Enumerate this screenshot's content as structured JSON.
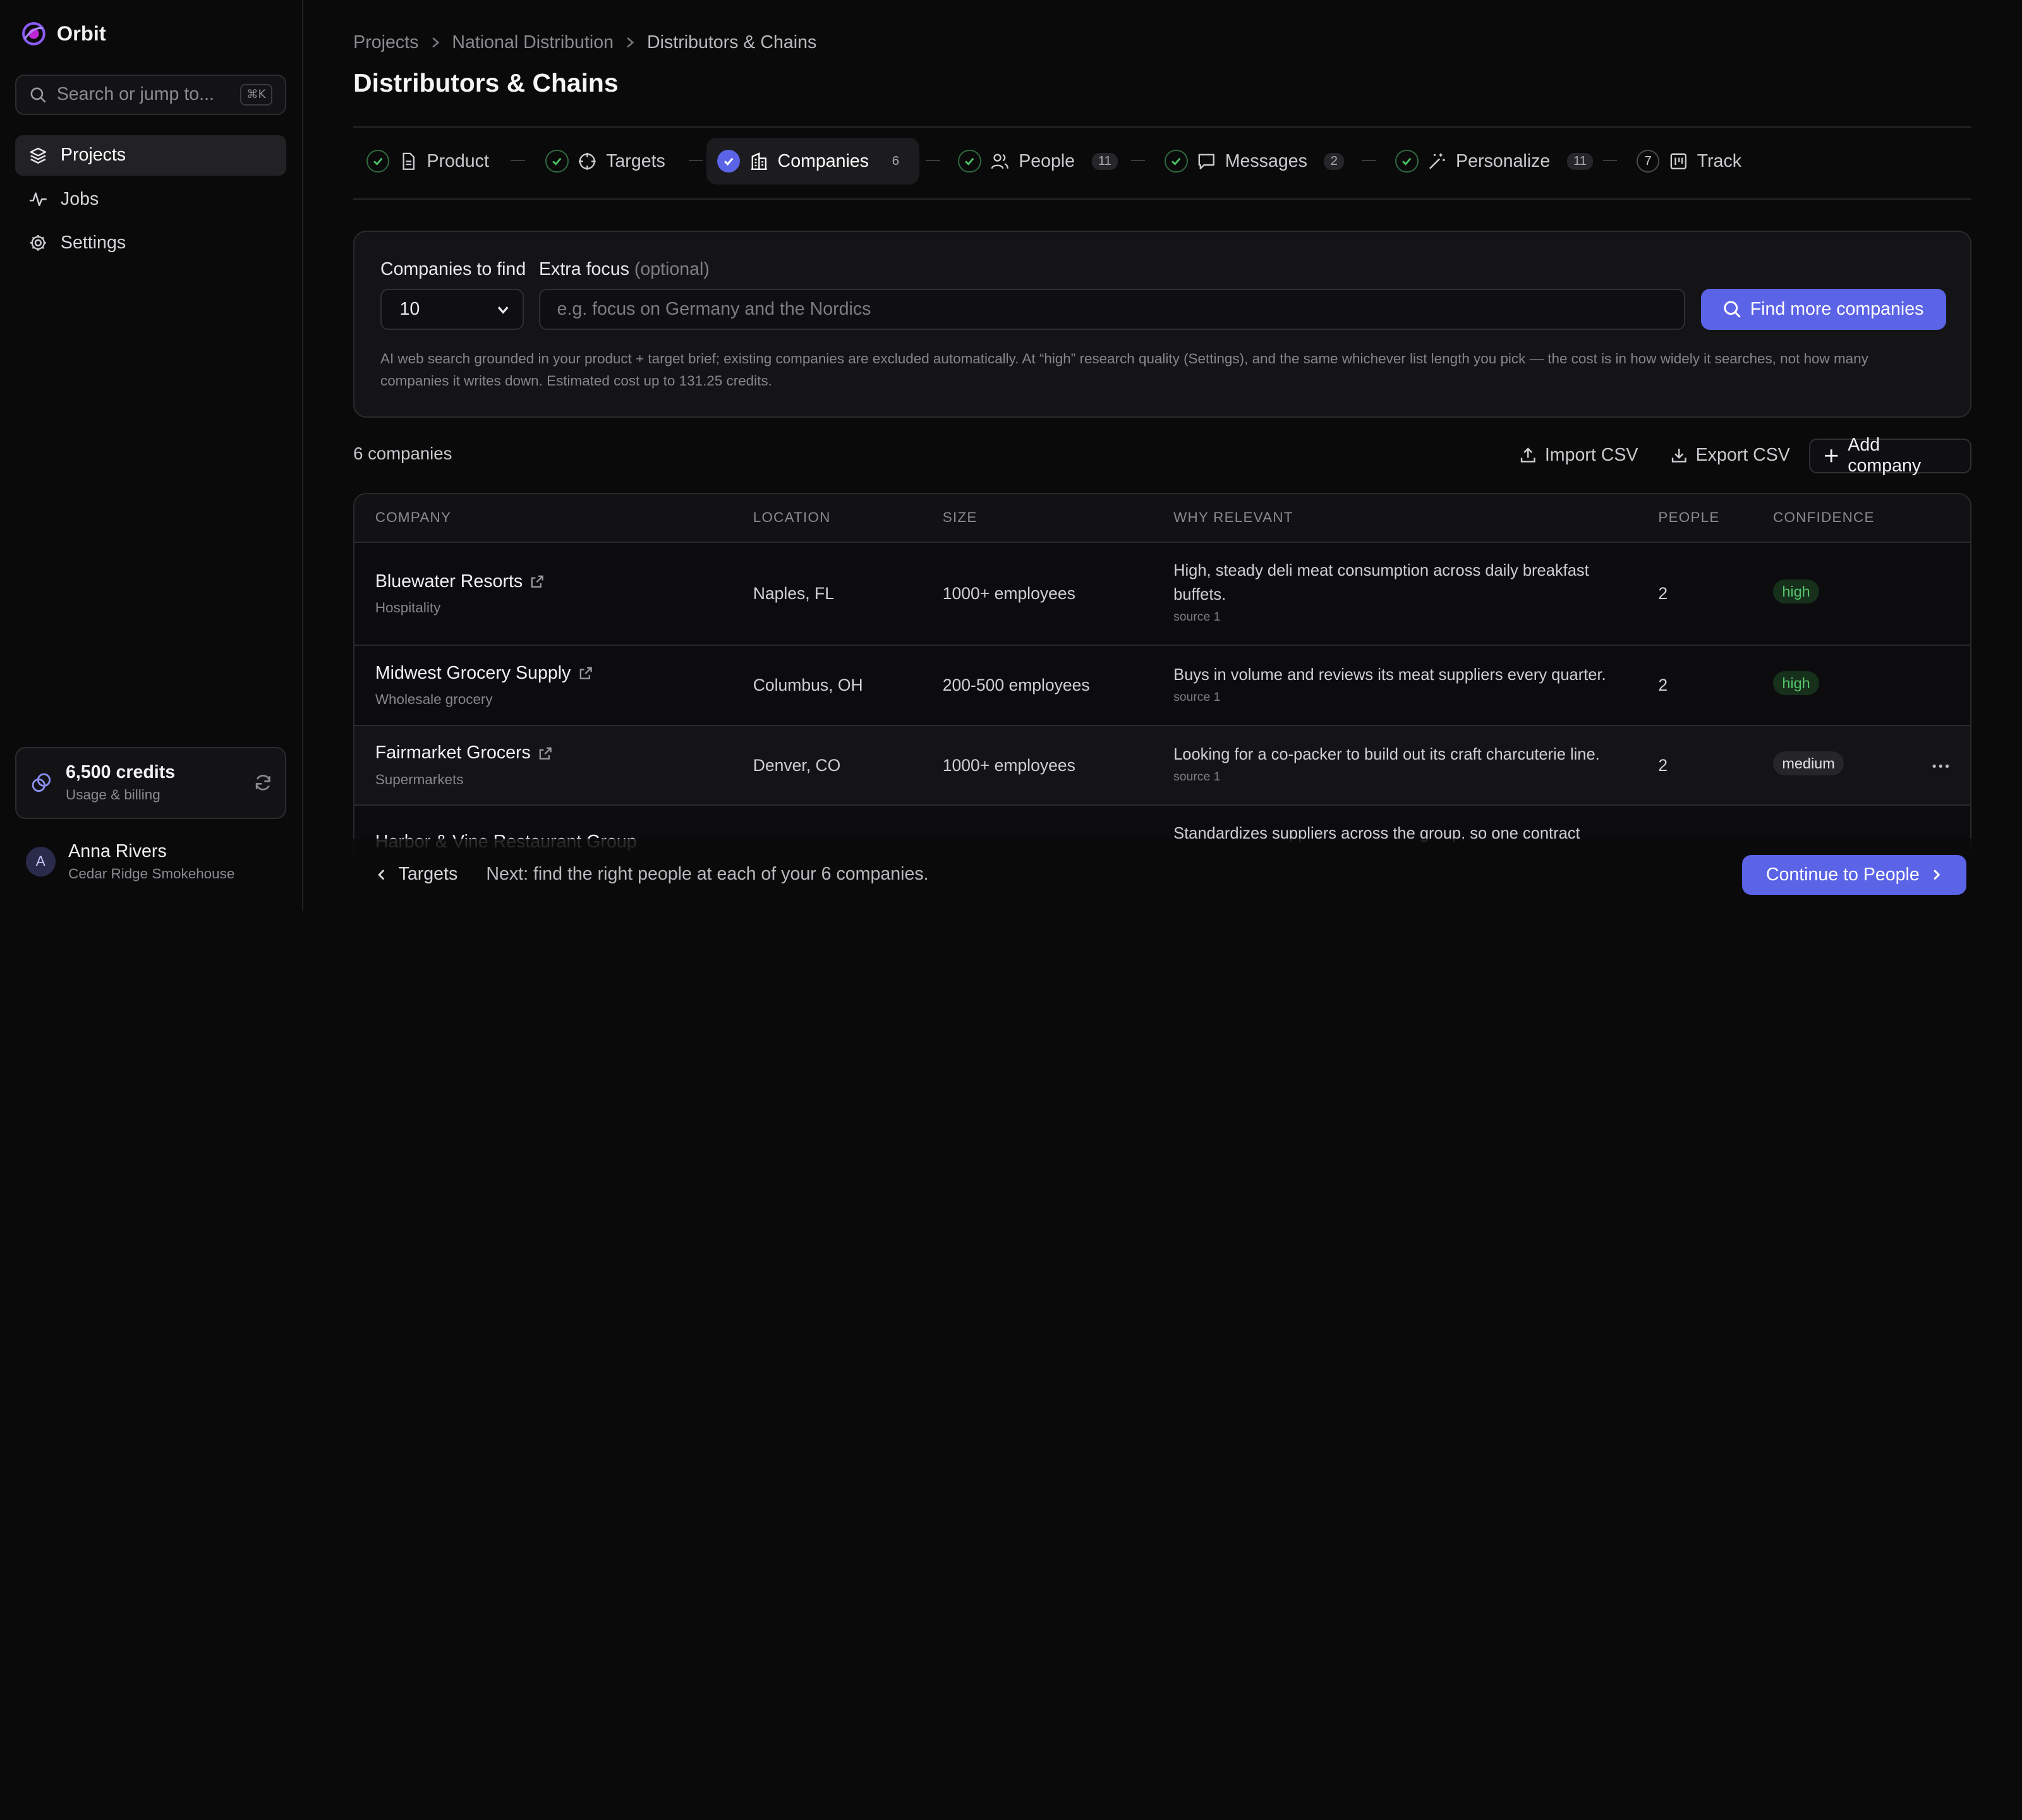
{
  "app": {
    "name": "Orbit"
  },
  "sidebar": {
    "search_placeholder": "Search or jump to...",
    "search_shortcut": "⌘K",
    "nav": [
      {
        "label": "Projects",
        "icon": "layers-icon",
        "active": true
      },
      {
        "label": "Jobs",
        "icon": "activity-icon",
        "active": false
      },
      {
        "label": "Settings",
        "icon": "gear-icon",
        "active": false
      }
    ],
    "credits": {
      "amount": "6,500 credits",
      "sub": "Usage & billing"
    },
    "user": {
      "initial": "A",
      "name": "Anna Rivers",
      "org": "Cedar Ridge Smokehouse"
    }
  },
  "breadcrumb": [
    "Projects",
    "National Distribution",
    "Distributors & Chains"
  ],
  "page_title": "Distributors & Chains",
  "steps": [
    {
      "label": "Product",
      "status": "done",
      "icon": "document-icon",
      "count": ""
    },
    {
      "label": "Targets",
      "status": "done",
      "icon": "target-icon",
      "count": ""
    },
    {
      "label": "Companies",
      "status": "active",
      "icon": "building-icon",
      "count": "6"
    },
    {
      "label": "People",
      "status": "done",
      "icon": "users-icon",
      "count": "11"
    },
    {
      "label": "Messages",
      "status": "done",
      "icon": "message-icon",
      "count": "2"
    },
    {
      "label": "Personalize",
      "status": "done",
      "icon": "wand-icon",
      "count": "11"
    },
    {
      "label": "Track",
      "status": "pending",
      "icon": "kanban-icon",
      "count": "",
      "number": "7"
    }
  ],
  "finder": {
    "count_label": "Companies to find",
    "count_value": "10",
    "focus_label": "Extra focus",
    "focus_optional": "(optional)",
    "focus_placeholder": "e.g. focus on Germany and the Nordics",
    "find_button": "Find more companies",
    "note": "AI web search grounded in your product + target brief; existing companies are excluded automatically. At “high” research quality (Settings), and the same whichever list length you pick — the cost is in how widely it searches, not how many companies it writes down. Estimated cost up to 131.25 credits."
  },
  "list": {
    "count_label": "6 companies",
    "import_label": "Import CSV",
    "export_label": "Export CSV",
    "add_label": "Add company"
  },
  "table": {
    "headers": [
      "Company",
      "Location",
      "Size",
      "Why relevant",
      "People",
      "Confidence"
    ],
    "rows": [
      {
        "name": "Bluewater Resorts",
        "industry": "Hospitality",
        "location": "Naples, FL",
        "size": "1000+ employees",
        "why": "High, steady deli meat consumption across daily breakfast buffets.",
        "source": "source 1",
        "people": "2",
        "confidence": "high"
      },
      {
        "name": "Midwest Grocery Supply",
        "industry": "Wholesale grocery",
        "location": "Columbus, OH",
        "size": "200-500 employees",
        "why": "Buys in volume and reviews its meat suppliers every quarter.",
        "source": "source 1",
        "people": "2",
        "confidence": "high"
      },
      {
        "name": "Fairmarket Grocers",
        "industry": "Supermarkets",
        "location": "Denver, CO",
        "size": "1000+ employees",
        "why": "Looking for a co-packer to build out its craft charcuterie line.",
        "source": "source 1",
        "people": "2",
        "confidence": "medium"
      },
      {
        "name": "Harbor & Vine Restaurant Group",
        "industry": "",
        "location": "",
        "size": "",
        "why": "Standardizes suppliers across the group, so one contract",
        "source": "",
        "people": "",
        "confidence": ""
      }
    ]
  },
  "footer": {
    "back_label": "Targets",
    "next_note": "Next: find the right people at each of your 6 companies.",
    "continue_label": "Continue to People"
  },
  "colors": {
    "accent": "#5b63e6",
    "high": "#56c26a",
    "background": "#0a0a0b"
  }
}
